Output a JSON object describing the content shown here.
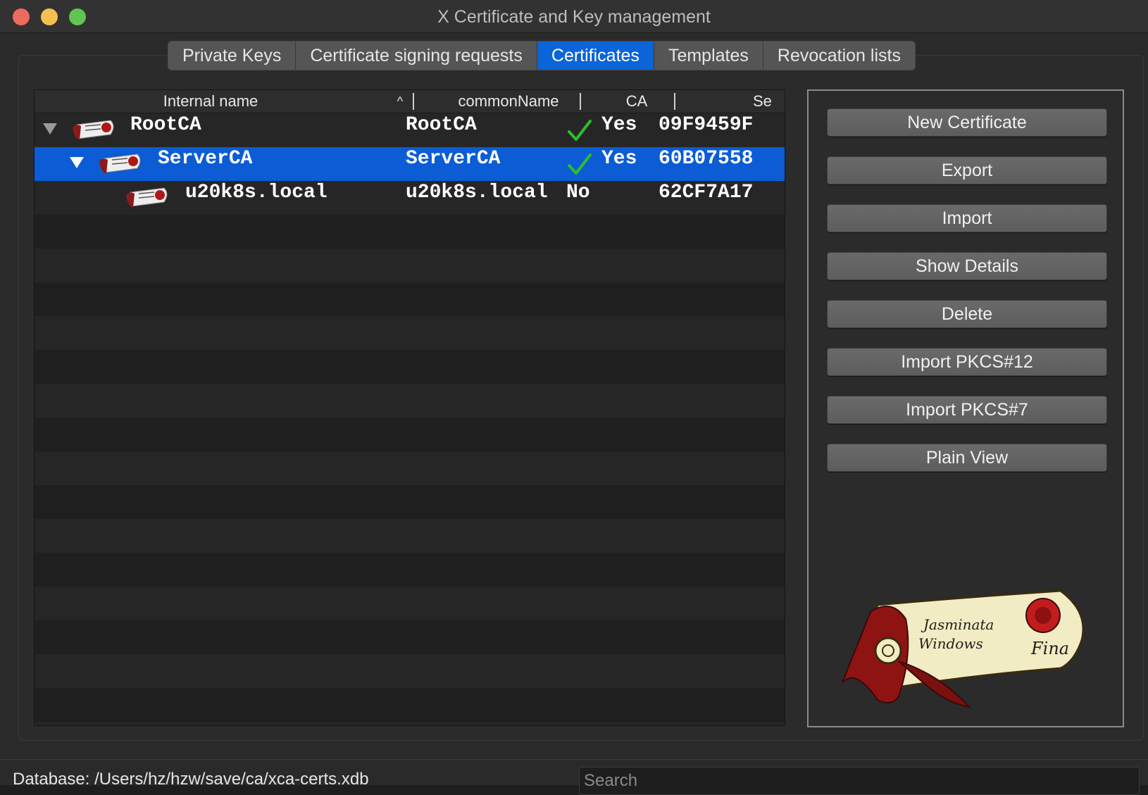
{
  "window": {
    "title": "X Certificate and Key management"
  },
  "tabs": [
    {
      "label": "Private Keys"
    },
    {
      "label": "Certificate signing requests"
    },
    {
      "label": "Certificates"
    },
    {
      "label": "Templates"
    },
    {
      "label": "Revocation lists"
    }
  ],
  "active_tab": "Certificates",
  "table": {
    "columns": [
      {
        "label": "Internal name"
      },
      {
        "label": "commonName"
      },
      {
        "label": "CA"
      },
      {
        "label": "Se"
      }
    ],
    "sort_indicator": "^",
    "rows": [
      {
        "internal_name": "RootCA",
        "common_name": "RootCA",
        "ca": "Yes",
        "serial": "09F9459F",
        "level": 0,
        "expanded": true,
        "ca_check": true
      },
      {
        "internal_name": "ServerCA",
        "common_name": "ServerCA",
        "ca": "Yes",
        "serial": "60B07558",
        "level": 1,
        "expanded": true,
        "ca_check": true,
        "selected": true
      },
      {
        "internal_name": "u20k8s.local",
        "common_name": "u20k8s.local",
        "ca": "No",
        "serial": "62CF7A17",
        "level": 2,
        "expanded": false,
        "ca_check": false
      }
    ]
  },
  "actions": [
    {
      "label": "New Certificate"
    },
    {
      "label": "Export"
    },
    {
      "label": "Import"
    },
    {
      "label": "Show Details"
    },
    {
      "label": "Delete"
    },
    {
      "label": "Import PKCS#12"
    },
    {
      "label": "Import PKCS#7"
    },
    {
      "label": "Plain View"
    }
  ],
  "logo": {
    "text_line1": "Jasminata",
    "text_line2": "Windows",
    "text_line3": "Fina"
  },
  "statusbar": {
    "database": "Database: /Users/hz/hzw/save/ca/xca-certs.xdb",
    "search_placeholder": "Search"
  },
  "colors": {
    "selection": "#0b5cd5",
    "active_tab": "#0b64d8",
    "check": "#2bbf2b"
  }
}
